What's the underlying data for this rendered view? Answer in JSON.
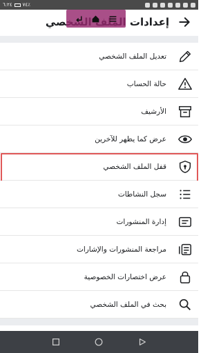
{
  "status_bar": {
    "time": "٦:٢٤",
    "battery": "٧٤٪"
  },
  "header": {
    "title": "إعدادات الملف الشخصي"
  },
  "menu": [
    {
      "label": "تعديل الملف الشخصي",
      "icon": "pencil-icon"
    },
    {
      "label": "حالة الحساب",
      "icon": "warning-icon"
    },
    {
      "label": "الأرشيف",
      "icon": "archive-icon"
    },
    {
      "label": "عرض كما يظهر للآخرين",
      "icon": "eye-icon"
    },
    {
      "label": "قفل الملف الشخصي",
      "icon": "shield-lock-icon"
    },
    {
      "label": "سجل النشاطات",
      "icon": "list-icon"
    },
    {
      "label": "إدارة المنشورات",
      "icon": "posts-icon"
    },
    {
      "label": "مراجعة المنشورات والإشارات",
      "icon": "tag-review-icon"
    },
    {
      "label": "عرض اختصارات الخصوصية",
      "icon": "lock-icon"
    },
    {
      "label": "بحث في الملف الشخصي",
      "icon": "search-icon"
    }
  ],
  "colors": {
    "highlight": "#e05858",
    "overlay": "#96286e",
    "nav_bar": "#3d4045",
    "status_bar": "#4a4a4a"
  }
}
